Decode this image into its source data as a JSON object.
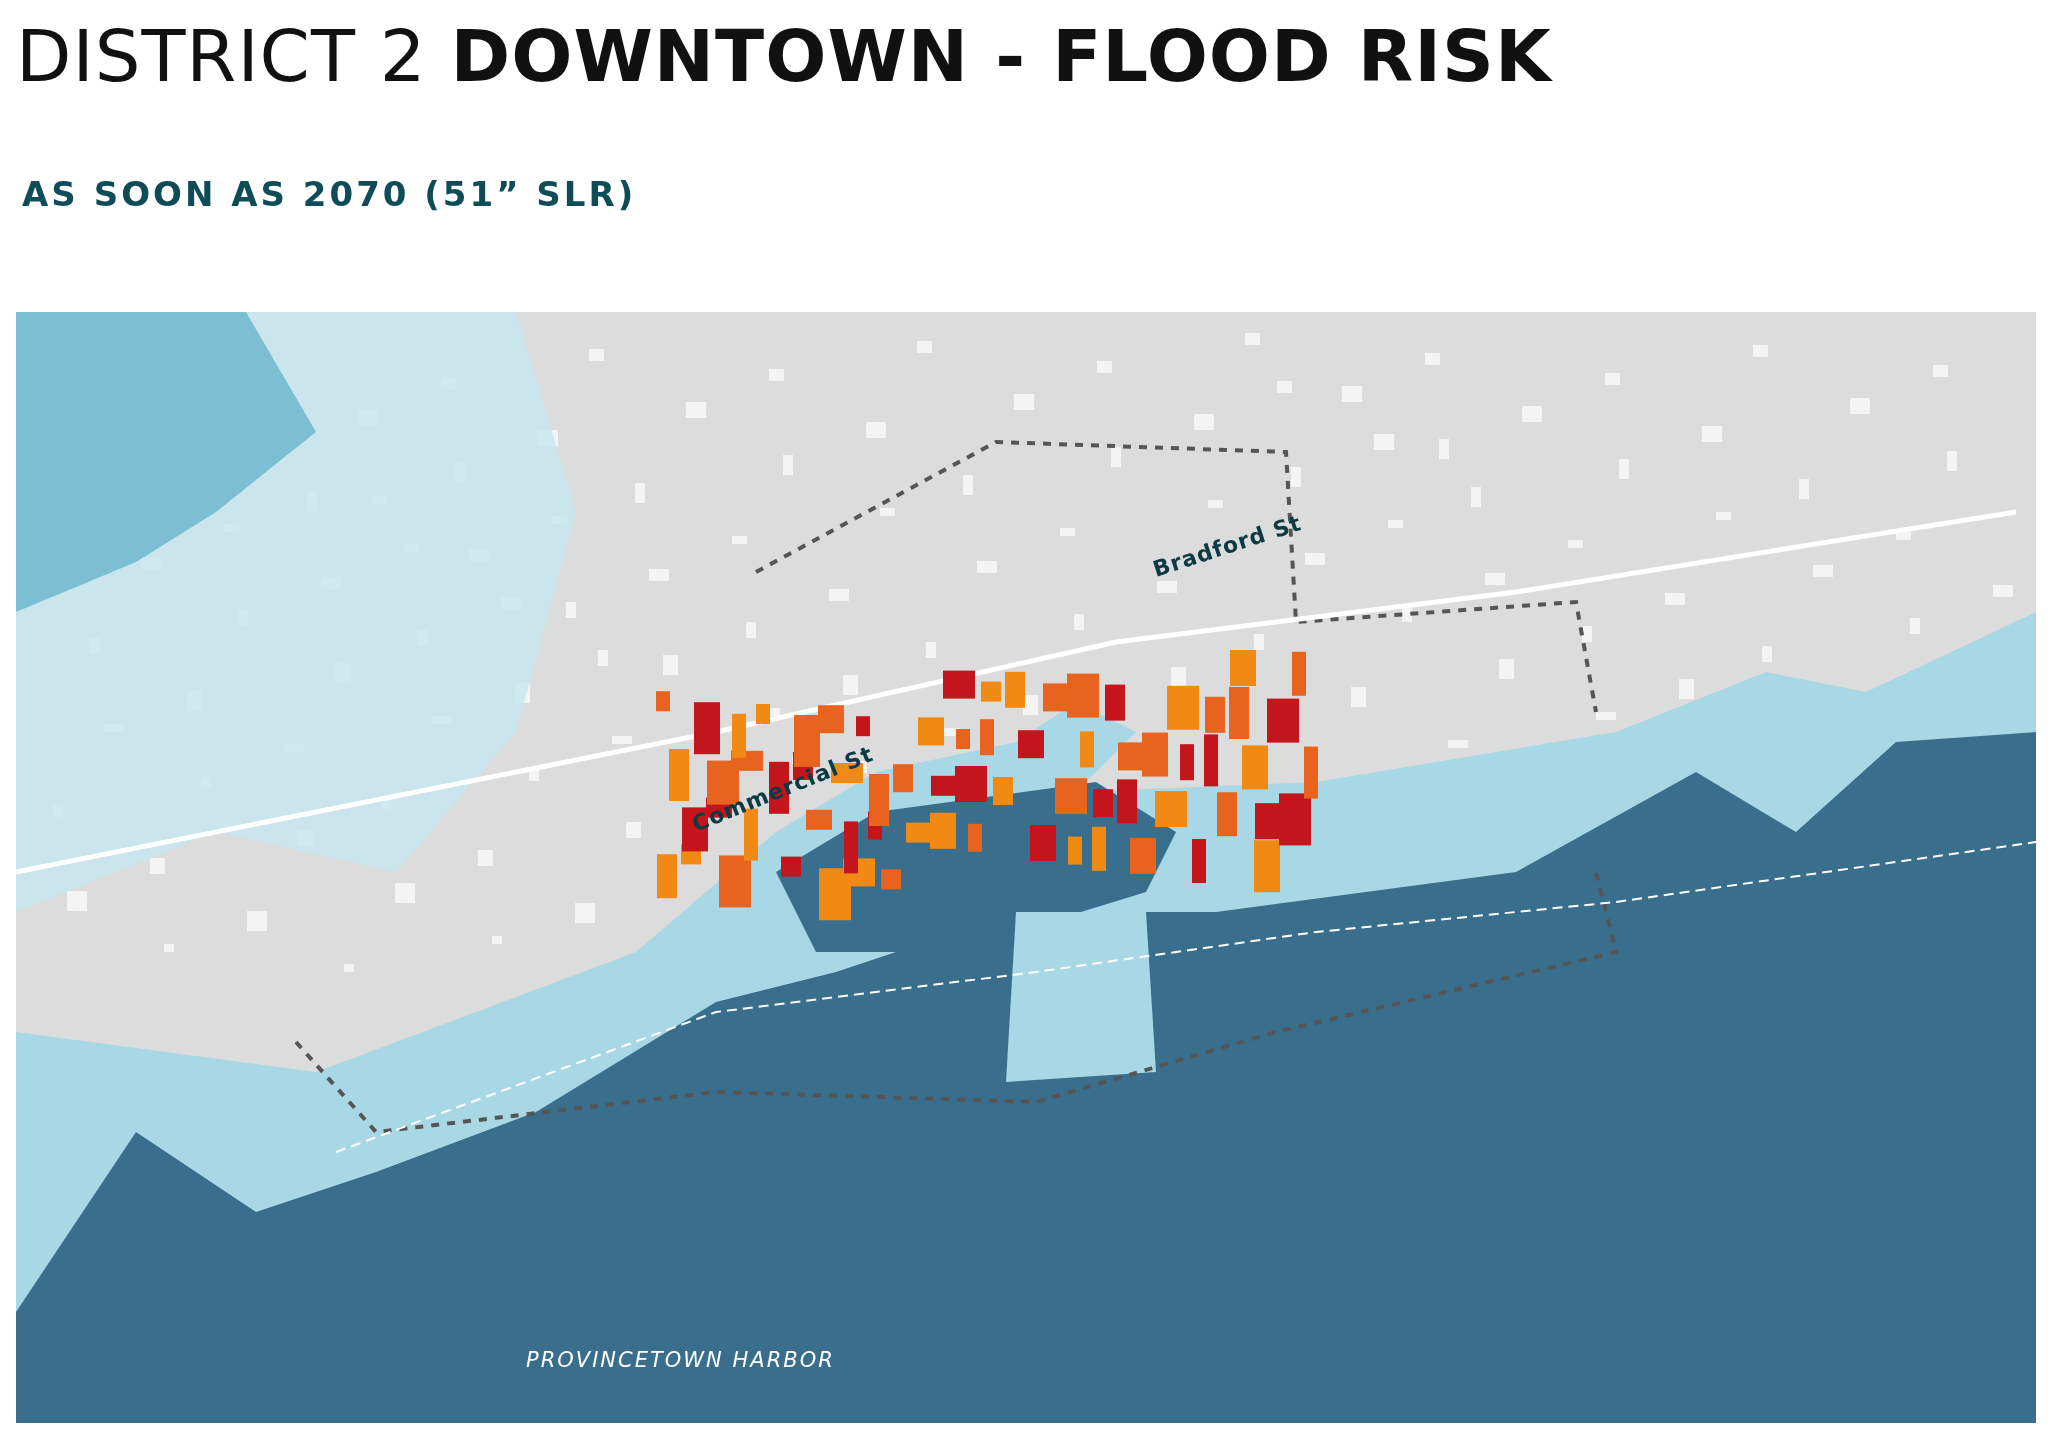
{
  "page": {
    "title": "DISTRICT 2 **DOWNTOWN - FLOOD RISK**",
    "subtitle": "AS SOON AS 2070 (51” SLR)"
  },
  "map": {
    "labels": [
      {
        "text": "Bradford St",
        "kind": "street"
      },
      {
        "text": "Commercial St",
        "kind": "street"
      },
      {
        "text": "PROVINCETOWN HARBOR",
        "kind": "water"
      }
    ]
  }
}
